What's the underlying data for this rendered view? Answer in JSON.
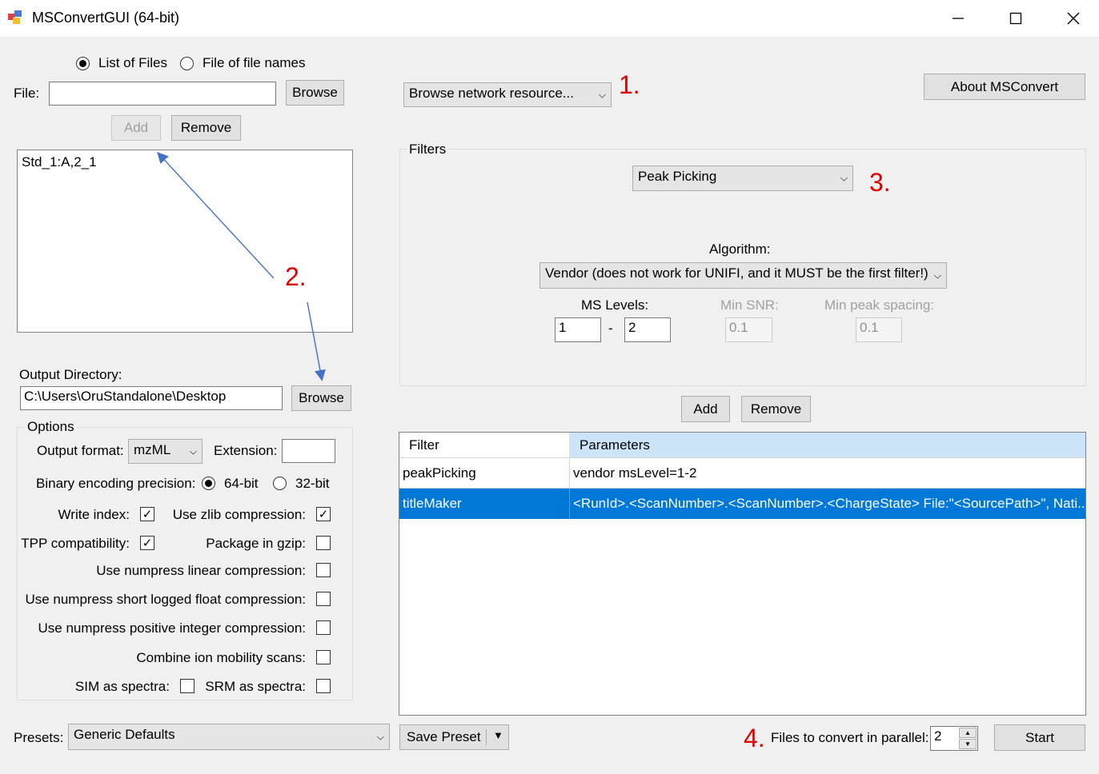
{
  "window": {
    "title": "MSConvertGUI (64-bit)"
  },
  "input": {
    "radio_list": "List of Files",
    "radio_file": "File of file names",
    "file_label": "File:",
    "file_value": "",
    "browse_label": "Browse",
    "add_label": "Add",
    "remove_label": "Remove",
    "files": [
      "Std_1:A,2_1"
    ]
  },
  "output": {
    "dir_label": "Output Directory:",
    "dir_value": "C:\\Users\\OruStandalone\\Desktop",
    "browse_label": "Browse"
  },
  "options": {
    "group_label": "Options",
    "format_label": "Output format:",
    "format_value": "mzML",
    "ext_label": "Extension:",
    "ext_value": "",
    "precision_label": "Binary encoding precision:",
    "p64": "64-bit",
    "p32": "32-bit",
    "write_index": "Write index:",
    "zlib": "Use zlib compression:",
    "tpp": "TPP compatibility:",
    "gzip": "Package in gzip:",
    "numpress_linear": "Use numpress linear compression:",
    "numpress_slof": "Use numpress short logged float compression:",
    "numpress_pic": "Use numpress positive integer compression:",
    "ion_mobility": "Combine ion mobility scans:",
    "sim": "SIM as spectra:",
    "srm": "SRM as spectra:"
  },
  "presets": {
    "label": "Presets:",
    "value": "Generic Defaults",
    "save_label": "Save Preset"
  },
  "network": {
    "value": "Browse network resource..."
  },
  "about_label": "About MSConvert",
  "filters": {
    "group_label": "Filters",
    "selected": "Peak Picking",
    "algorithm_label": "Algorithm:",
    "algorithm_value": "Vendor (does not work for UNIFI, and it MUST be the first filter!)",
    "ms_levels_label": "MS Levels:",
    "ms_from": "1",
    "dash": "-",
    "ms_to": "2",
    "min_snr_label": "Min SNR:",
    "min_snr_value": "0.1",
    "min_spacing_label": "Min peak spacing:",
    "min_spacing_value": "0.1",
    "add_label": "Add",
    "remove_label": "Remove",
    "grid": {
      "columns": [
        "Filter",
        "Parameters"
      ],
      "rows": [
        {
          "filter": "peakPicking",
          "params": "vendor msLevel=1-2"
        },
        {
          "filter": "titleMaker",
          "params": "<RunId>.<ScanNumber>.<ScanNumber>.<ChargeState> File:\"<SourcePath>\", Nati..."
        }
      ]
    }
  },
  "parallel": {
    "label": "Files to convert in parallel:",
    "value": "2"
  },
  "start_label": "Start",
  "annotations": {
    "a1": "1.",
    "a2": "2.",
    "a3": "3.",
    "a4": "4."
  },
  "colors": {
    "selection": "#0078d7",
    "annotation": "#e00000",
    "arrow": "#4472c4"
  }
}
